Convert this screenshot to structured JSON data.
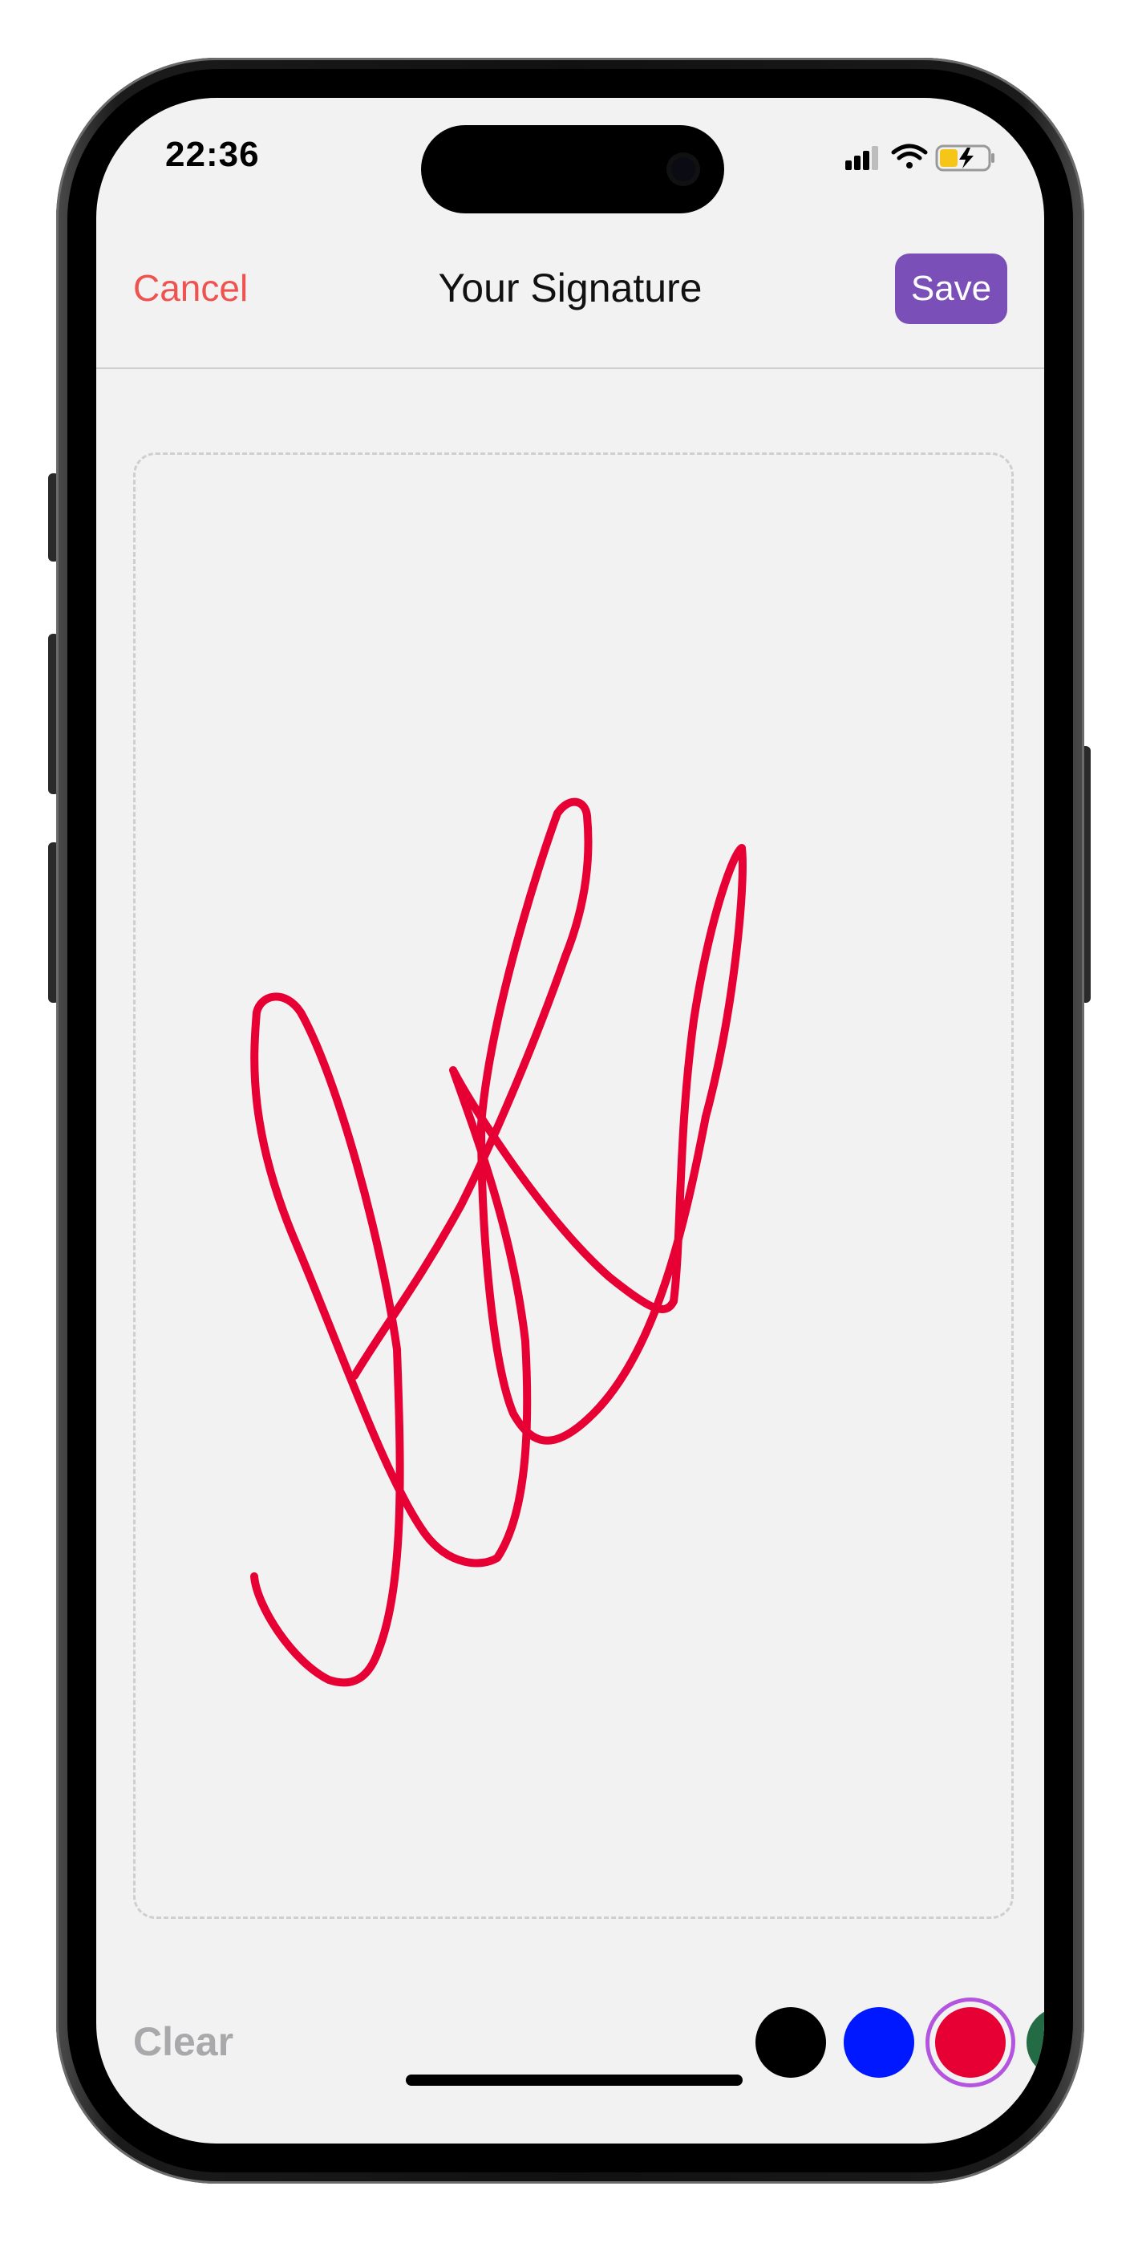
{
  "status_bar": {
    "time": "22:36",
    "icons": [
      "signal-icon",
      "wifi-icon",
      "battery-charging-icon"
    ]
  },
  "nav": {
    "cancel_label": "Cancel",
    "title": "Your Signature",
    "save_label": "Save"
  },
  "toolbar": {
    "clear_label": "Clear",
    "colors": [
      {
        "name": "black",
        "hex": "#000000",
        "selected": false
      },
      {
        "name": "blue",
        "hex": "#0018ff",
        "selected": false
      },
      {
        "name": "red",
        "hex": "#e60034",
        "selected": true
      },
      {
        "name": "green",
        "hex": "#226b44",
        "selected": false
      }
    ]
  },
  "colors": {
    "accent": "#7b4fb8",
    "cancel": "#ef5350",
    "ink": "#e60034",
    "selected_ring": "#b455e0"
  }
}
